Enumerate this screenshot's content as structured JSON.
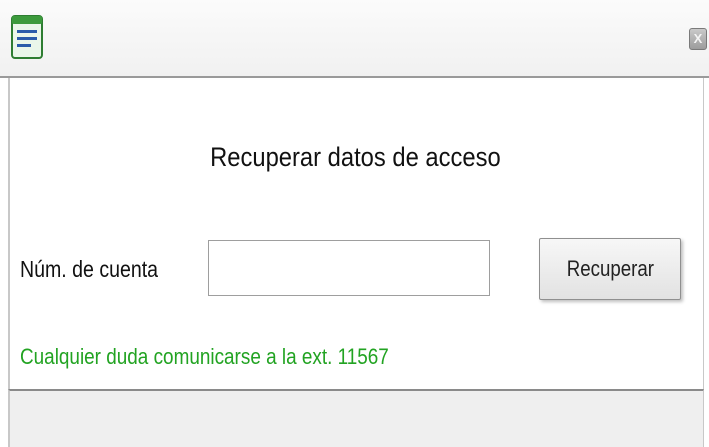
{
  "window": {
    "app_icon": "notepad-icon",
    "close_label": "X"
  },
  "dialog": {
    "title": "Recuperar datos de acceso",
    "account_label": "Núm. de cuenta",
    "account_value": "",
    "recover_button_label": "Recuperar",
    "help_text": "Cualquier duda comunicarse a la ext. 11567"
  },
  "colors": {
    "help_text": "#22a322",
    "titlebar_border": "#9a9a9a",
    "footer_bg": "#efefef"
  }
}
